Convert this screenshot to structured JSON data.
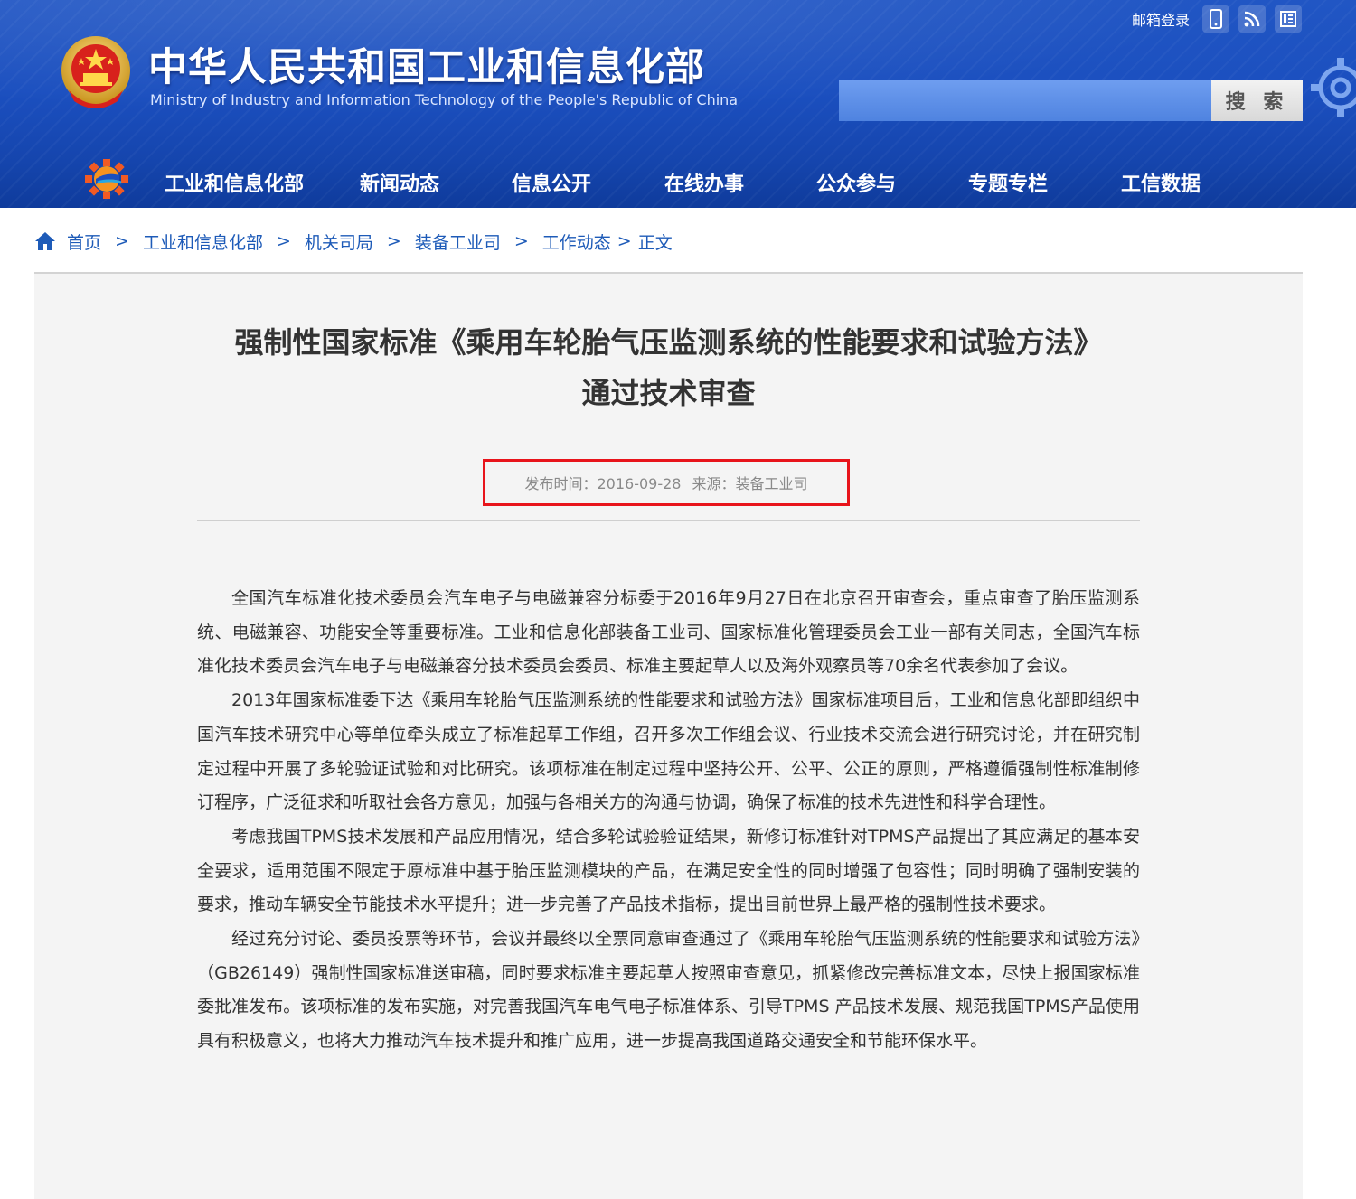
{
  "header": {
    "site_title": "中华人民共和国工业和信息化部",
    "site_title_en": "Ministry of Industry and Information Technology of the People's Republic of China",
    "mail_login": "邮箱登录",
    "search_button": "搜 索",
    "top_icons": [
      "mobile-icon",
      "rss-icon",
      "weibo-icon"
    ]
  },
  "nav": {
    "items": [
      "工业和信息化部",
      "新闻动态",
      "信息公开",
      "在线办事",
      "公众参与",
      "专题专栏",
      "工信数据"
    ]
  },
  "breadcrumb": {
    "items": [
      "首页",
      "工业和信息化部",
      "机关司局",
      "装备工业司",
      "工作动态",
      "正文"
    ],
    "separator": ">"
  },
  "article": {
    "title_line1": "强制性国家标准《乘用车轮胎气压监测系统的性能要求和试验方法》",
    "title_line2": "通过技术审查",
    "publish_label": "发布时间：2016-09-28",
    "source_label": "来源：装备工业司",
    "paragraphs": [
      "全国汽车标准化技术委员会汽车电子与电磁兼容分标委于2016年9月27日在北京召开审查会，重点审查了胎压监测系统、电磁兼容、功能安全等重要标准。工业和信息化部装备工业司、国家标准化管理委员会工业一部有关同志，全国汽车标准化技术委员会汽车电子与电磁兼容分技术委员会委员、标准主要起草人以及海外观察员等70余名代表参加了会议。",
      "2013年国家标准委下达《乘用车轮胎气压监测系统的性能要求和试验方法》国家标准项目后，工业和信息化部即组织中国汽车技术研究中心等单位牵头成立了标准起草工作组，召开多次工作组会议、行业技术交流会进行研究讨论，并在研究制定过程中开展了多轮验证试验和对比研究。该项标准在制定过程中坚持公开、公平、公正的原则，严格遵循强制性标准制修订程序，广泛征求和听取社会各方意见，加强与各相关方的沟通与协调，确保了标准的技术先进性和科学合理性。",
      "考虑我国TPMS技术发展和产品应用情况，结合多轮试验验证结果，新修订标准针对TPMS产品提出了其应满足的基本安全要求，适用范围不限定于原标准中基于胎压监测模块的产品，在满足安全性的同时增强了包容性；同时明确了强制安装的要求，推动车辆安全节能技术水平提升；进一步完善了产品技术指标，提出目前世界上最严格的强制性技术要求。",
      "经过充分讨论、委员投票等环节，会议并最终以全票同意审查通过了《乘用车轮胎气压监测系统的性能要求和试验方法》（GB26149）强制性国家标准送审稿，同时要求标准主要起草人按照审查意见，抓紧修改完善标准文本，尽快上报国家标准委批准发布。该项标准的发布实施，对完善我国汽车电气电子标准体系、引导TPMS 产品技术发展、规范我国TPMS产品使用具有积极意义，也将大力推动汽车技术提升和推广应用，进一步提高我国道路交通安全和节能环保水平。"
    ]
  },
  "colors": {
    "header_blue": "#1b4fbf",
    "link_blue": "#1e5bb8",
    "highlight_red": "#e8141b",
    "article_bg": "#f4f4f4"
  }
}
